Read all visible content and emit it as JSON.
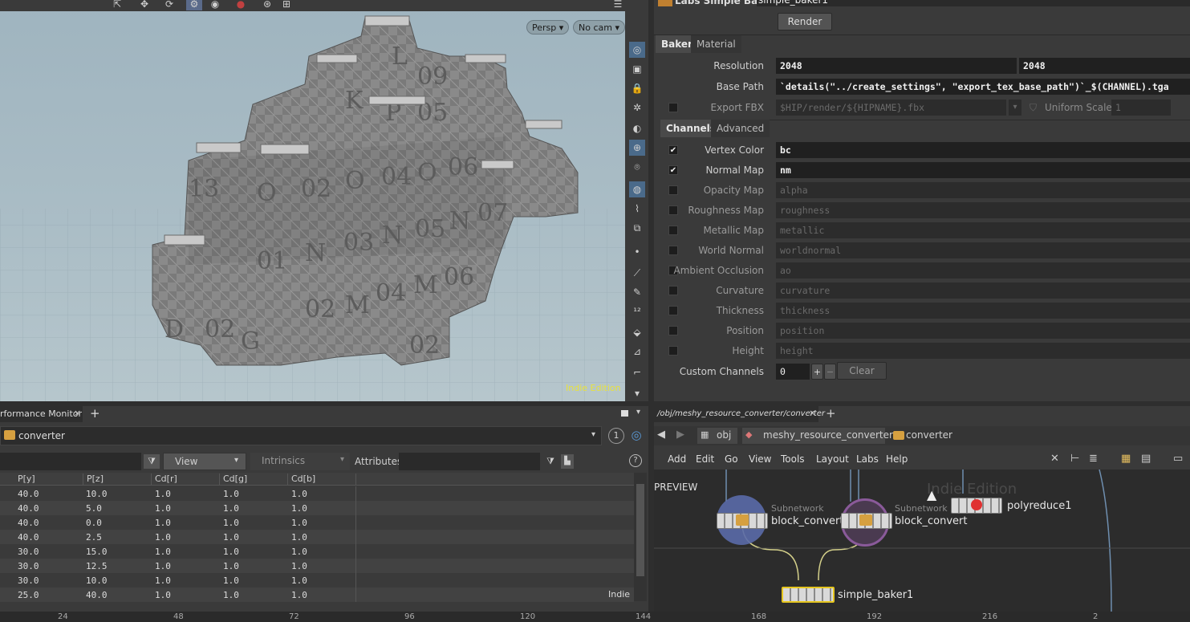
{
  "viewport": {
    "persp_label": "Persp",
    "cam_label": "No cam",
    "edition": "Indie Edition"
  },
  "params": {
    "node_type": "Labs Simple Baker",
    "node_name": "simple_baker1",
    "render_label": "Render",
    "tabs": [
      "Baker",
      "Material"
    ],
    "resolution_label": "Resolution",
    "resolution_x": "2048",
    "resolution_y": "2048",
    "base_path_label": "Base Path",
    "base_path_value": "`details(\"../create_settings\", \"export_tex_base_path\")`_$(CHANNEL).tga",
    "export_fbx_label": "Export FBX",
    "export_fbx_value": "$HIP/render/${HIPNAME}.fbx",
    "uniform_scale_label": "Uniform Scale",
    "uniform_scale_value": "1",
    "sub_tabs": [
      "Channels",
      "Advanced"
    ],
    "channels": [
      {
        "label": "Vertex Color",
        "value": "bc",
        "checked": true
      },
      {
        "label": "Normal Map",
        "value": "nm",
        "checked": true
      },
      {
        "label": "Opacity Map",
        "value": "alpha",
        "checked": false
      },
      {
        "label": "Roughness Map",
        "value": "roughness",
        "checked": false
      },
      {
        "label": "Metallic Map",
        "value": "metallic",
        "checked": false
      },
      {
        "label": "World Normal",
        "value": "worldnormal",
        "checked": false
      },
      {
        "label": "Ambient Occlusion",
        "value": "ao",
        "checked": false
      },
      {
        "label": "Curvature",
        "value": "curvature",
        "checked": false
      },
      {
        "label": "Thickness",
        "value": "thickness",
        "checked": false
      },
      {
        "label": "Position",
        "value": "position",
        "checked": false
      },
      {
        "label": "Height",
        "value": "height",
        "checked": false
      }
    ],
    "custom_channels_label": "Custom Channels",
    "custom_channels_value": "0",
    "clear_label": "Clear"
  },
  "sheet": {
    "tab_label": "rformance Monitor",
    "node": "converter",
    "view_label": "View",
    "intrinsics_label": "Intrinsics",
    "attributes_label": "Attributes:",
    "columns": [
      "P[y]",
      "P[z]",
      "Cd[r]",
      "Cd[g]",
      "Cd[b]"
    ],
    "rows": [
      [
        "40.0",
        "10.0",
        "1.0",
        "1.0",
        "1.0"
      ],
      [
        "40.0",
        "5.0",
        "1.0",
        "1.0",
        "1.0"
      ],
      [
        "40.0",
        "0.0",
        "1.0",
        "1.0",
        "1.0"
      ],
      [
        "40.0",
        "2.5",
        "1.0",
        "1.0",
        "1.0"
      ],
      [
        "30.0",
        "15.0",
        "1.0",
        "1.0",
        "1.0"
      ],
      [
        "30.0",
        "12.5",
        "1.0",
        "1.0",
        "1.0"
      ],
      [
        "30.0",
        "10.0",
        "1.0",
        "1.0",
        "1.0"
      ],
      [
        "25.0",
        "40.0",
        "1.0",
        "1.0",
        "1.0"
      ]
    ],
    "indie": "Indie",
    "badge": "1"
  },
  "network": {
    "path_tab": "/obj/meshy_resource_converter/converter",
    "crumbs": [
      "obj",
      "meshy_resource_converter",
      "converter"
    ],
    "menu": [
      "Add",
      "Edit",
      "Go",
      "View",
      "Tools",
      "Layout",
      "Labs",
      "Help"
    ],
    "preview_label": "PREVIEW",
    "watermark": "Indie Edition",
    "nodes": {
      "block1_sub": "Subnetwork",
      "block1": "block_convert",
      "block2_sub": "Subnetwork",
      "block2": "block_convert",
      "poly": "polyreduce1",
      "baker": "simple_baker1"
    }
  },
  "ruler": [
    "24",
    "48",
    "72",
    "96",
    "120",
    "144",
    "168",
    "192",
    "216",
    "2"
  ]
}
